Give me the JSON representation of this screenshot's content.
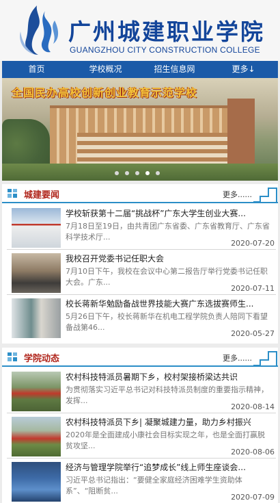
{
  "header": {
    "school_name_cn": "广州城建职业学院",
    "school_name_en": "GUANGZHOU CITY CONSTRUCTION COLLEGE",
    "logo_icon": "flame-logo-icon"
  },
  "nav": {
    "items": [
      {
        "label": "首页"
      },
      {
        "label": "学校概况"
      },
      {
        "label": "招生信息网"
      },
      {
        "label": "更多↓"
      }
    ]
  },
  "banner": {
    "caption": "全国民办高校创新创业教育示范学校",
    "slide_count": 5,
    "active_slide": 4
  },
  "sections": [
    {
      "title": "城建要闻",
      "more": "更多......",
      "items": [
        {
          "title": "学校斩获第十二届“挑战杯”广东大学生创业大赛...",
          "desc": "7月18日至19日，由共青团广东省委、广东省教育厅、广东省科学技术厅...",
          "date": "2020-07-20"
        },
        {
          "title": "我校召开党委书记任职大会",
          "desc": "7月10日下午，我校在会议中心第二报告厅举行党委书记任职大会。广东...",
          "date": "2020-07-11"
        },
        {
          "title": "校长蒋新华勉励备战世界技能大赛广东选拔赛师生...",
          "desc": "5月26日下午，校长蒋新华在机电工程学院负责人陪同下看望备战第46...",
          "date": "2020-05-27"
        }
      ]
    },
    {
      "title": "学院动态",
      "more": "更多......",
      "items": [
        {
          "title": "农村科技特派员暑期下乡，校村架接桥梁达共识",
          "desc": "为贯彻落实习近平总书记对科技特派员制度的重要指示精神，发挥...",
          "date": "2020-08-14"
        },
        {
          "title": "农村科技特派员下乡| 凝聚城建力量，助力乡村振兴",
          "desc": "2020年是全面建成小康社会目标实现之年，也是全面打赢脱贫攻坚...",
          "date": "2020-08-06"
        },
        {
          "title": "经济与管理学院举行“追梦成长”线上师生座谈会...",
          "desc": "习近平总书记指出：“要健全家庭经济困难学生资助体系”、“阻断贫...",
          "date": "2020-07-09"
        }
      ]
    }
  ],
  "colors": {
    "brand_blue": "#13459a",
    "nav_blue": "#1b5aa8",
    "section_title_red": "#b0251b",
    "accent_line": "#2b8ec7"
  }
}
